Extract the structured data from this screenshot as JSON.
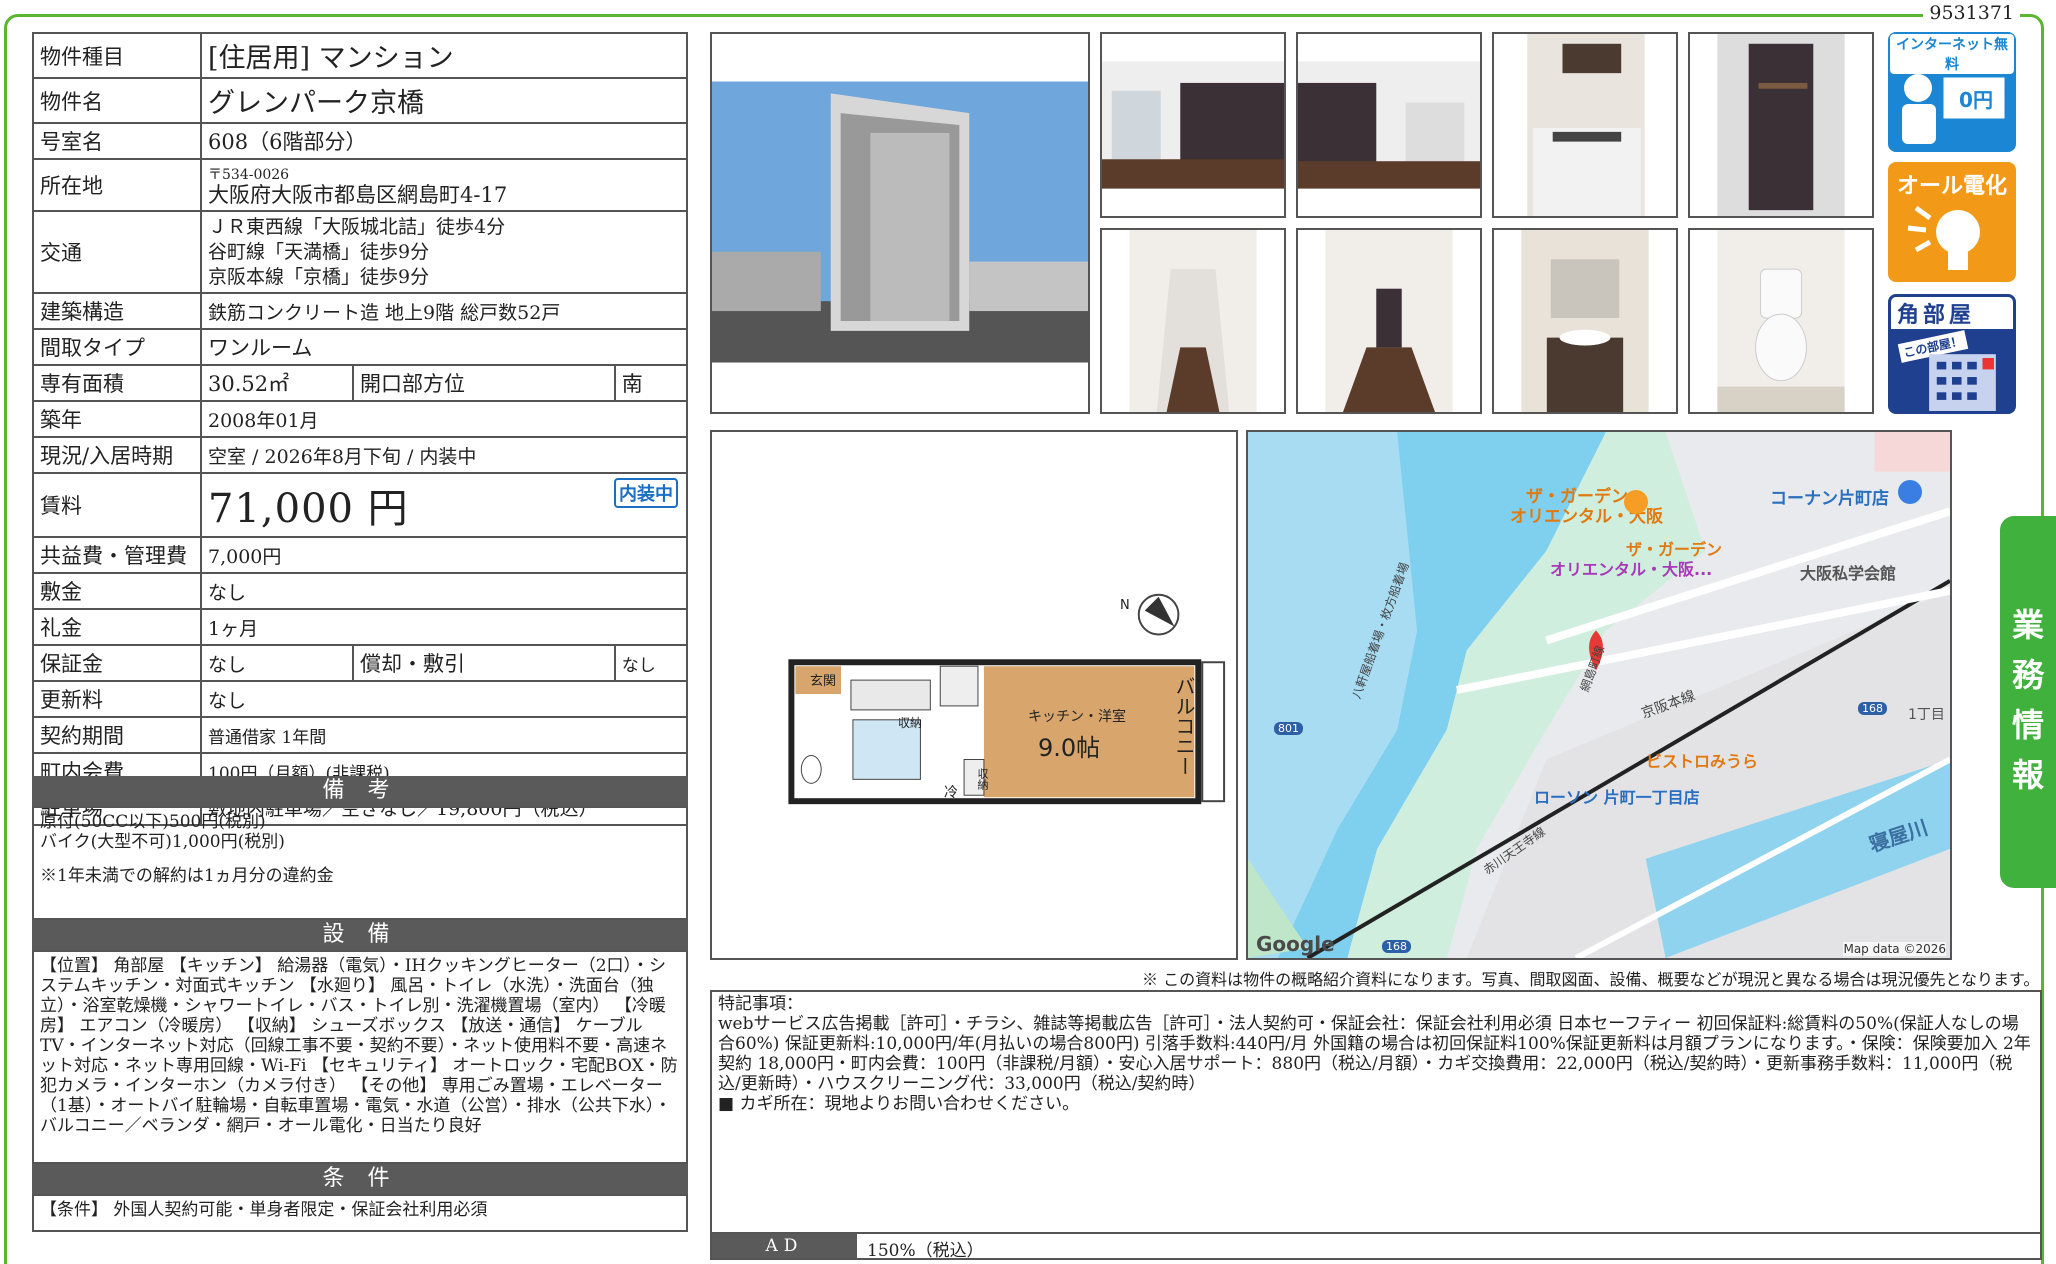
{
  "doc_id": "9531371",
  "fields": {
    "type_label": "物件種目",
    "type_value": "[住居用] マンション",
    "name_label": "物件名",
    "name_value": "グレンパーク京橋",
    "room_label": "号室名",
    "room_value": "608（6階部分）",
    "addr_label": "所在地",
    "addr_zip": "〒534-0026",
    "addr_value": "大阪府大阪市都島区網島町4-17",
    "access_label": "交通",
    "access_1": "ＪＲ東西線「大阪城北詰」徒歩4分",
    "access_2": "谷町線「天満橋」徒歩9分",
    "access_3": "京阪本線「京橋」徒歩9分",
    "struct_label": "建築構造",
    "struct_value": "鉄筋コンクリート造 地上9階 総戸数52戸",
    "layout_label": "間取タイプ",
    "layout_value": "ワンルーム",
    "area_label": "専有面積",
    "area_value": "30.52㎡",
    "open_label": "開口部方位",
    "open_value": "南",
    "built_label": "築年",
    "built_value": "2008年01月",
    "status_label": "現況/入居時期",
    "status_value": "空室 / 2026年8月下旬 / 内装中",
    "rent_label": "賃料",
    "rent_value": "71,000 円",
    "rent_badge": "内装中",
    "fee_label": "共益費・管理費",
    "fee_value": "7,000円",
    "shiki_label": "敷金",
    "shiki_value": "なし",
    "rei_label": "礼金",
    "rei_value": "1ヶ月",
    "hosho_label": "保証金",
    "hosho_value": "なし",
    "shokyaku_label": "償却・敷引",
    "shokyaku_value": "なし",
    "koshin_label": "更新料",
    "koshin_value": "なし",
    "keiyaku_label": "契約期間",
    "keiyaku_value": "普通借家 1年間",
    "chonai_label": "町内会費",
    "chonai_value": "100円（月額）(非課税)",
    "parking_label": "駐車場",
    "parking_value": "敷地内駐車場／空きなし／19,800円（税込）"
  },
  "biko": {
    "title": "備 考",
    "line1": "原付(50CC以下)500円(税別)",
    "line2": "バイク(大型不可)1,000円(税別)",
    "line3": "※1年未満での解約は1ヵ月分の違約金"
  },
  "setsubi": {
    "title": "設 備",
    "text": "【位置】 角部屋 【キッチン】 給湯器（電気）・IHクッキングヒーター（2口）・システムキッチン・対面式キッチン 【水廻り】 風呂・トイレ（水洗）・洗面台（独立）・浴室乾燥機・シャワートイレ・バス・トイレ別・洗濯機置場（室内） 【冷暖房】 エアコン（冷暖房） 【収納】 シューズボックス 【放送・通信】 ケーブルTV・インターネット対応（回線工事不要・契約不要）・ネット使用料不要・高速ネット対応・ネット専用回線・Wi-Fi 【セキュリティ】 オートロック・宅配BOX・防犯カメラ・インターホン（カメラ付き） 【その他】 専用ごみ置場・エレベーター（1基）・オートバイ駐輪場・自転車置場・電気・水道（公営）・排水（公共下水）・バルコニー／ベランダ・網戸・オール電化・日当たり良好"
  },
  "joken": {
    "title": "条 件",
    "text": "【条件】 外国人契約可能・単身者限定・保証会社利用必須"
  },
  "icons": {
    "internet": "インターネット無料",
    "internet_price": "0円",
    "allelec": "オール電化",
    "corner": "角部屋",
    "corner_sub": "この部屋！"
  },
  "floorplan": {
    "genkan": "玄関",
    "shuno1": "収納",
    "shuno2": "収納",
    "rei": "冷",
    "kitchen": "キッチン・洋室",
    "jo": "9.0帖",
    "balcony": "バルコニー",
    "north": "N"
  },
  "map": {
    "p1": "ザ・ガーデン",
    "p1b": "オリエンタル・大阪",
    "p2": "ザ・ガーデン",
    "p2b": "オリエンタル・大阪...",
    "p3": "コーナン片町店",
    "p4": "大阪私学会館",
    "p5": "ビストロみうら",
    "p6": "ローソン 片町一丁目店",
    "r1": "京阪本線",
    "r2": "網島町線",
    "r3": "赤川天王寺線",
    "r4": "八軒屋船着場・枚方船着場",
    "riv": "寝屋川",
    "cho": "1丁目",
    "n801": "801",
    "n168a": "168",
    "n168b": "168",
    "google": "Google",
    "mapdata": "Map data ©2026"
  },
  "side_label": "業務情報",
  "note": "※ この資料は物件の概略紹介資料になります。写真、間取図面、設備、概要などが現況と異なる場合は現況優先となります。",
  "tokki": {
    "head": "特記事項：",
    "body": "webサービス広告掲載［許可］・チラシ、雑誌等掲載広告［許可］・法人契約可・保証会社：保証会社利用必須 日本セーフティー 初回保証料:総賃料の50%(保証人なしの場合60%) 保証更新料:10,000円/年(月払いの場合800円) 引落手数料:440円/月 外国籍の場合は初回保証料100%保証更新料は月額プランになります。・保険：保険要加入 2年契約 18,000円・町内会費：100円（非課税/月額）・安心入居サポート：880円（税込/月額）・カギ交換費用：22,000円（税込/契約時）・更新事務手数料：11,000円（税込/更新時）・ハウスクリーニング代：33,000円（税込/契約時）",
    "key": "■ カギ所在：現地よりお問い合わせください。"
  },
  "ad": {
    "label": "AD",
    "value": "150%（税込）"
  }
}
